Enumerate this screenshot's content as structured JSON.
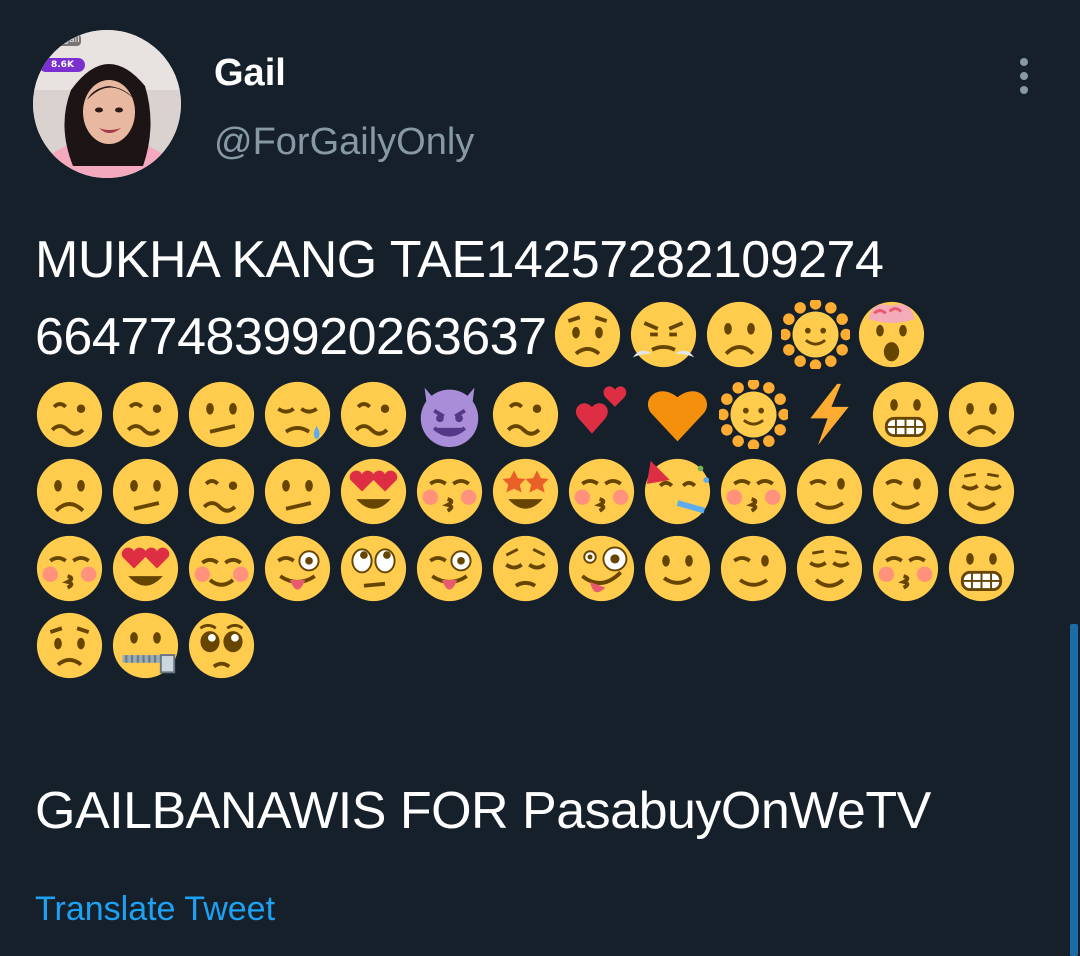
{
  "profile": {
    "display_name": "Gail",
    "handle": "@ForGailyOnly",
    "avatar_badge": "8.6K",
    "avatar_tag": "struggail"
  },
  "tweet": {
    "line1": "MUKHA KANG TAE142572821092​74",
    "line2_text": "6647748399202636​37",
    "line2_emojis": [
      "worried",
      "triumph",
      "frown",
      "sun",
      "exploding",
      "woozy"
    ],
    "emoji_rows": [
      [
        "woozy",
        "confused",
        "sleepy",
        "woozy",
        "devil",
        "woozy",
        "two-hearts",
        "orange-heart",
        "sun",
        "zap",
        "grimace",
        "frown",
        "woozy"
      ],
      [
        "frown",
        "confused",
        "woozy",
        "confused",
        "heart-eyes",
        "kiss-blush",
        "star-struck",
        "kiss-blush",
        "party",
        "kiss-blush",
        "wink",
        "wink",
        "relieved"
      ],
      [
        "kiss-blush",
        "heart-eyes",
        "smiling-blush",
        "tongue-wink",
        "roll-eyes",
        "tongue-wink",
        "pensive",
        "zany",
        "slight-smile",
        "wink",
        "relieved",
        "kiss-blush",
        "grimace"
      ],
      [
        "worried",
        "zipper",
        "pleading"
      ]
    ],
    "footer": "GAILBANAWIS FOR PasabuyOnWeTV",
    "translate_label": "Translate Tweet"
  },
  "colors": {
    "background": "#15202b",
    "text": "#ffffff",
    "secondary": "#8899a6",
    "link": "#1da1f2",
    "emoji_yellow": "#ffcc4d"
  }
}
